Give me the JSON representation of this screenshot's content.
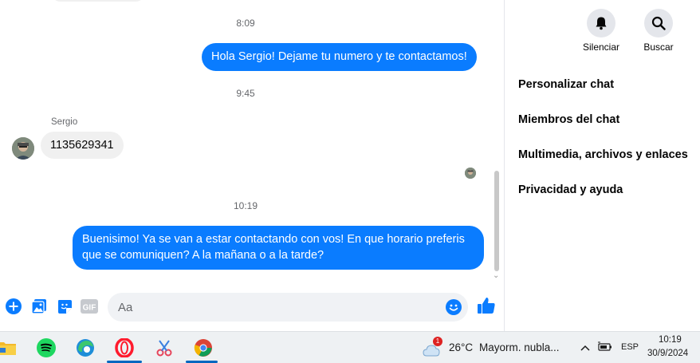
{
  "messages": {
    "time_1": "8:09",
    "out_1": "Hola Sergio! Dejame tu numero y te contactamos!",
    "time_2": "9:45",
    "sender_name": "Sergio",
    "in_1": "1135629341",
    "time_3": "10:19",
    "out_2": "Buenisimo! Ya se van a estar contactando con vos! En que horario preferis que se comuniquen? A la mañana o a la tarde?"
  },
  "composer": {
    "placeholder": "Aa",
    "gif_label": "GIF"
  },
  "sidebar": {
    "mute_label": "Silenciar",
    "search_label": "Buscar",
    "items": [
      {
        "label": "Personalizar chat"
      },
      {
        "label": "Miembros del chat"
      },
      {
        "label": "Multimedia, archivos y enlaces"
      },
      {
        "label": "Privacidad y ayuda"
      }
    ]
  },
  "taskbar": {
    "weather_badge": "1",
    "temperature": "26°C",
    "weather_text": "Mayorm. nubla...",
    "language": "ESP",
    "time": "10:19",
    "date": "30/9/2024"
  },
  "colors": {
    "accent": "#0a7cff",
    "bubble_in": "#f0f0f0"
  }
}
